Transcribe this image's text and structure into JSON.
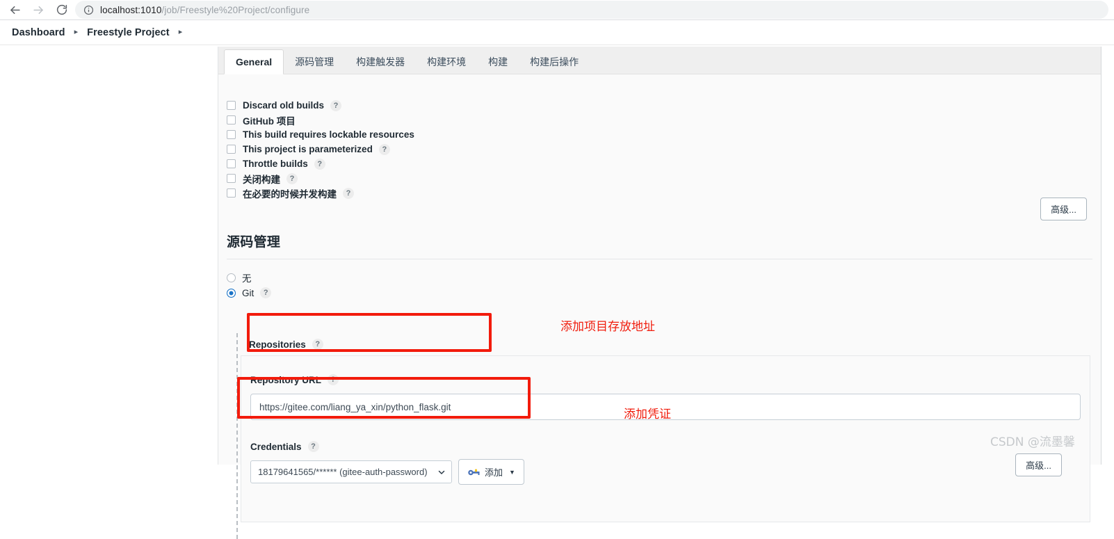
{
  "browser": {
    "back_icon": "arrow-left-icon",
    "forward_icon": "arrow-right-icon",
    "reload_icon": "reload-icon",
    "info_icon": "info-circle-icon",
    "url_host": "localhost:1010",
    "url_path": "/job/Freestyle%20Project/configure"
  },
  "breadcrumb": {
    "items": [
      {
        "label": "Dashboard"
      },
      {
        "label": "Freestyle Project"
      }
    ],
    "arrow": "▸"
  },
  "tabs": [
    {
      "label": "General",
      "active": true
    },
    {
      "label": "源码管理",
      "active": false
    },
    {
      "label": "构建触发器",
      "active": false
    },
    {
      "label": "构建环境",
      "active": false
    },
    {
      "label": "构建",
      "active": false
    },
    {
      "label": "构建后操作",
      "active": false
    }
  ],
  "general": {
    "checkboxes": [
      {
        "label": "Discard old builds",
        "checked": false,
        "help": true
      },
      {
        "label": "GitHub 项目",
        "checked": false,
        "help": false
      },
      {
        "label": "This build requires lockable resources",
        "checked": false,
        "help": false
      },
      {
        "label": "This project is parameterized",
        "checked": false,
        "help": true
      },
      {
        "label": "Throttle builds",
        "checked": false,
        "help": true
      },
      {
        "label": "关闭构建",
        "checked": false,
        "help": true
      },
      {
        "label": "在必要的时候并发构建",
        "checked": false,
        "help": true
      }
    ],
    "advanced_label": "高级..."
  },
  "scm": {
    "title": "源码管理",
    "radios": [
      {
        "label": "无",
        "selected": false,
        "help": false
      },
      {
        "label": "Git",
        "selected": true,
        "help": true
      }
    ],
    "repositories_label": "Repositories",
    "repository_url_label": "Repository URL",
    "repository_url_value": "https://gitee.com/liang_ya_xin/python_flask.git",
    "repository_url_placeholder": "",
    "credentials_label": "Credentials",
    "credentials_value": "18179641565/****** (gitee-auth-password)",
    "credentials_options": [
      "18179641565/****** (gitee-auth-password)"
    ],
    "credentials_chevron": "⌄",
    "add_credential_label": "添加",
    "add_credential_icon": "key-icon",
    "add_credential_caret": "▼",
    "advanced_label": "高级..."
  },
  "annotations": {
    "help_glyph": "?",
    "note_repository_url": "添加项目存放地址",
    "note_credentials": "添加凭证",
    "color_red": "#f21b0c"
  },
  "watermark": {
    "text": "CSDN @流墨馨"
  }
}
